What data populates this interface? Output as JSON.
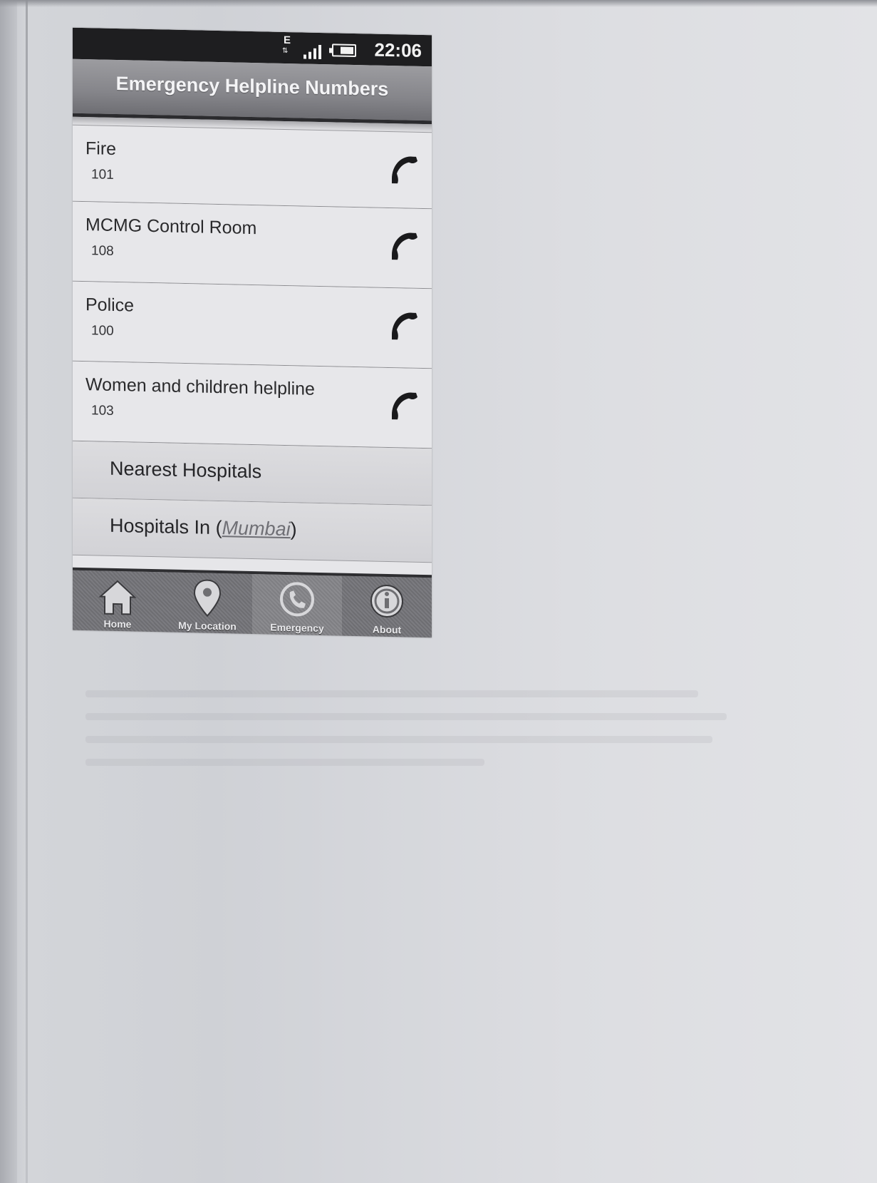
{
  "status_bar": {
    "network_type": "E",
    "time": "22:06"
  },
  "header": {
    "title": "Emergency Helpline Numbers"
  },
  "contacts": [
    {
      "name": "Fire",
      "number": "101",
      "icon": "phone-icon"
    },
    {
      "name": "MCMG Control Room",
      "number": "108",
      "icon": "phone-icon"
    },
    {
      "name": "Police",
      "number": "100",
      "icon": "phone-icon"
    },
    {
      "name": "Women and children helpline",
      "number": "103",
      "icon": "phone-icon"
    }
  ],
  "nav_rows": {
    "nearest_hospitals": "Nearest Hospitals",
    "hospitals_in_prefix": "Hospitals In (",
    "hospitals_in_city": "Mumbai",
    "hospitals_in_suffix": ")"
  },
  "tabbar": {
    "active_tab": "Emergency",
    "tabs": [
      {
        "label": "Home",
        "icon": "home-icon"
      },
      {
        "label": "My Location",
        "icon": "location-pin-icon"
      },
      {
        "label": "Emergency",
        "icon": "emergency-phone-icon"
      },
      {
        "label": "About",
        "icon": "info-icon"
      }
    ]
  },
  "colors": {
    "status_bar": "#1e1e20",
    "header": "#85858a",
    "list_background": "#e7e7ea",
    "tabbar": "#747478"
  }
}
